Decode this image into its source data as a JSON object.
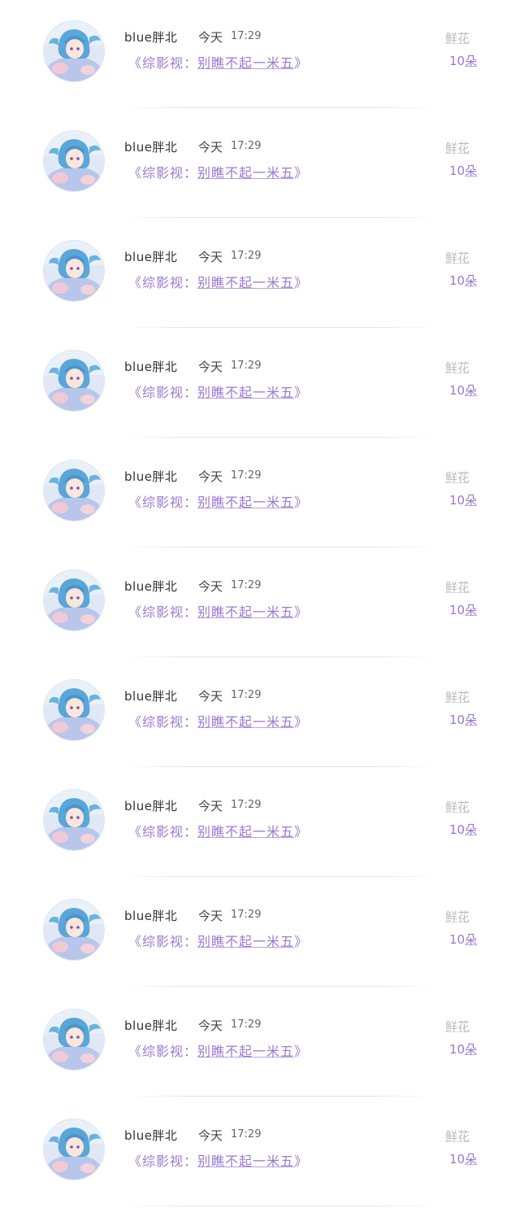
{
  "items": [
    {
      "user": "blue胖北",
      "day": "今天",
      "time": "17:29",
      "book_open": "《",
      "book_series": "综影视",
      "book_sep": "：",
      "book_title": "别瞧不起一米五",
      "book_close": "》",
      "gift_label": "鲜花",
      "gift_count": "10",
      "gift_unit": "朵"
    },
    {
      "user": "blue胖北",
      "day": "今天",
      "time": "17:29",
      "book_open": "《",
      "book_series": "综影视",
      "book_sep": "：",
      "book_title": "别瞧不起一米五",
      "book_close": "》",
      "gift_label": "鲜花",
      "gift_count": "10",
      "gift_unit": "朵"
    },
    {
      "user": "blue胖北",
      "day": "今天",
      "time": "17:29",
      "book_open": "《",
      "book_series": "综影视",
      "book_sep": "：",
      "book_title": "别瞧不起一米五",
      "book_close": "》",
      "gift_label": "鲜花",
      "gift_count": "10",
      "gift_unit": "朵"
    },
    {
      "user": "blue胖北",
      "day": "今天",
      "time": "17:29",
      "book_open": "《",
      "book_series": "综影视",
      "book_sep": "：",
      "book_title": "别瞧不起一米五",
      "book_close": "》",
      "gift_label": "鲜花",
      "gift_count": "10",
      "gift_unit": "朵"
    },
    {
      "user": "blue胖北",
      "day": "今天",
      "time": "17:29",
      "book_open": "《",
      "book_series": "综影视",
      "book_sep": "：",
      "book_title": "别瞧不起一米五",
      "book_close": "》",
      "gift_label": "鲜花",
      "gift_count": "10",
      "gift_unit": "朵"
    },
    {
      "user": "blue胖北",
      "day": "今天",
      "time": "17:29",
      "book_open": "《",
      "book_series": "综影视",
      "book_sep": "：",
      "book_title": "别瞧不起一米五",
      "book_close": "》",
      "gift_label": "鲜花",
      "gift_count": "10",
      "gift_unit": "朵"
    },
    {
      "user": "blue胖北",
      "day": "今天",
      "time": "17:29",
      "book_open": "《",
      "book_series": "综影视",
      "book_sep": "：",
      "book_title": "别瞧不起一米五",
      "book_close": "》",
      "gift_label": "鲜花",
      "gift_count": "10",
      "gift_unit": "朵"
    },
    {
      "user": "blue胖北",
      "day": "今天",
      "time": "17:29",
      "book_open": "《",
      "book_series": "综影视",
      "book_sep": "：",
      "book_title": "别瞧不起一米五",
      "book_close": "》",
      "gift_label": "鲜花",
      "gift_count": "10",
      "gift_unit": "朵"
    },
    {
      "user": "blue胖北",
      "day": "今天",
      "time": "17:29",
      "book_open": "《",
      "book_series": "综影视",
      "book_sep": "：",
      "book_title": "别瞧不起一米五",
      "book_close": "》",
      "gift_label": "鲜花",
      "gift_count": "10",
      "gift_unit": "朵"
    },
    {
      "user": "blue胖北",
      "day": "今天",
      "time": "17:29",
      "book_open": "《",
      "book_series": "综影视",
      "book_sep": "：",
      "book_title": "别瞧不起一米五",
      "book_close": "》",
      "gift_label": "鲜花",
      "gift_count": "10",
      "gift_unit": "朵"
    },
    {
      "user": "blue胖北",
      "day": "今天",
      "time": "17:29",
      "book_open": "《",
      "book_series": "综影视",
      "book_sep": "：",
      "book_title": "别瞧不起一米五",
      "book_close": "》",
      "gift_label": "鲜花",
      "gift_count": "10",
      "gift_unit": "朵"
    }
  ],
  "colors": {
    "accent": "#9a78d2",
    "muted": "#bbbbbb",
    "text": "#333333"
  },
  "icons": {
    "avatar": "anime-avatar-icon"
  }
}
